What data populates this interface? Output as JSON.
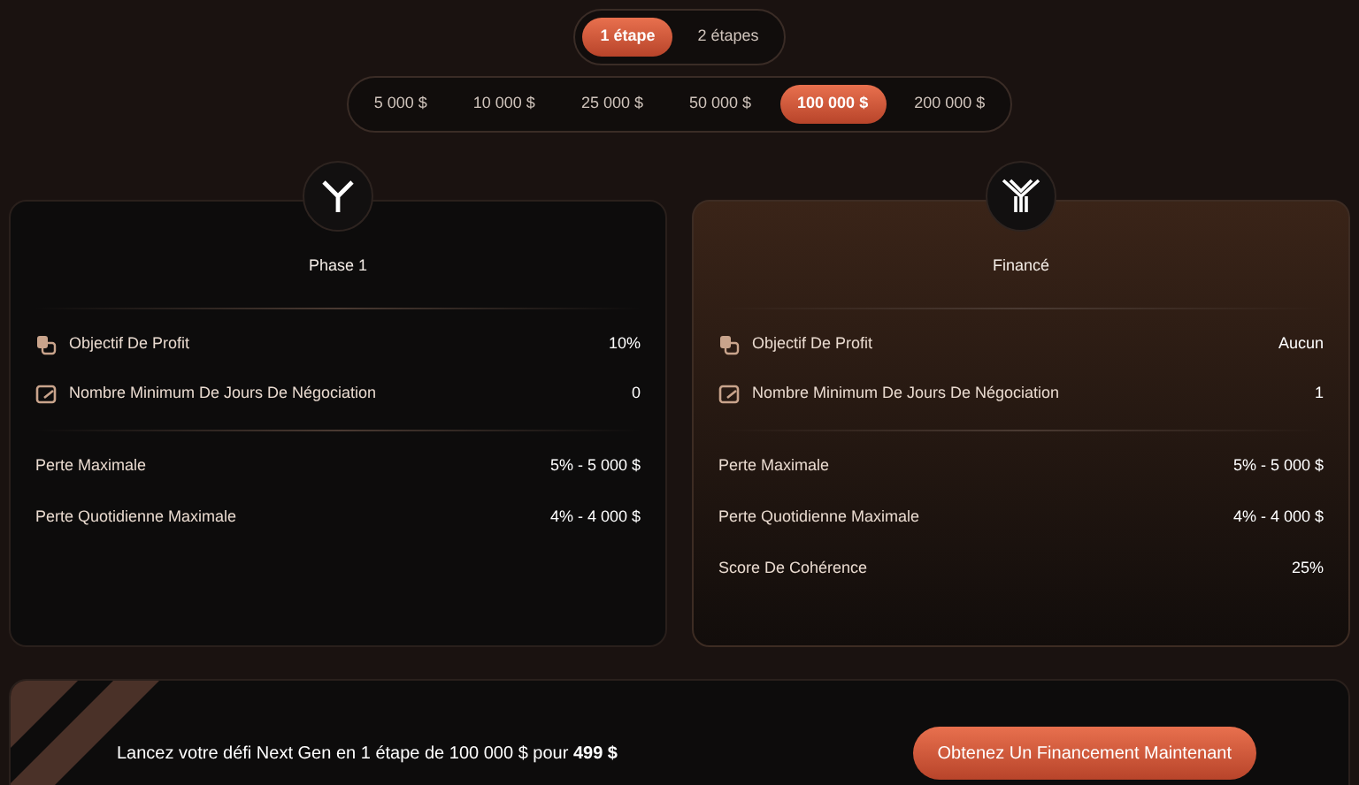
{
  "steps": [
    {
      "label": "1 étape",
      "selected": true
    },
    {
      "label": "2 étapes",
      "selected": false
    }
  ],
  "amounts": [
    {
      "label": "5 000 $",
      "selected": false
    },
    {
      "label": "10 000 $",
      "selected": false
    },
    {
      "label": "25 000 $",
      "selected": false
    },
    {
      "label": "50 000 $",
      "selected": false
    },
    {
      "label": "100 000 $",
      "selected": true
    },
    {
      "label": "200 000 $",
      "selected": false
    }
  ],
  "cards": [
    {
      "title": "Phase 1",
      "highlighted": false,
      "feature_rows": [
        {
          "label": "Objectif De Profit",
          "value": "10%"
        },
        {
          "label": "Nombre Minimum De Jours De Négociation",
          "value": "0"
        }
      ],
      "rule_rows": [
        {
          "label": "Perte Maximale",
          "value": "5% - 5 000 $"
        },
        {
          "label": "Perte Quotidienne Maximale",
          "value": "4% - 4 000 $"
        }
      ]
    },
    {
      "title": "Financé",
      "highlighted": true,
      "feature_rows": [
        {
          "label": "Objectif De Profit",
          "value": "Aucun"
        },
        {
          "label": "Nombre Minimum De Jours De Négociation",
          "value": "1"
        }
      ],
      "rule_rows": [
        {
          "label": "Perte Maximale",
          "value": "5% - 5 000 $"
        },
        {
          "label": "Perte Quotidienne Maximale",
          "value": "4% - 4 000 $"
        },
        {
          "label": "Score De Cohérence",
          "value": "25%"
        }
      ]
    }
  ],
  "banner": {
    "text": "Lancez votre défi Next Gen en 1 étape de 100 000 $ pour **499 $**",
    "button": "Obtenez Un Financement Maintenant"
  }
}
